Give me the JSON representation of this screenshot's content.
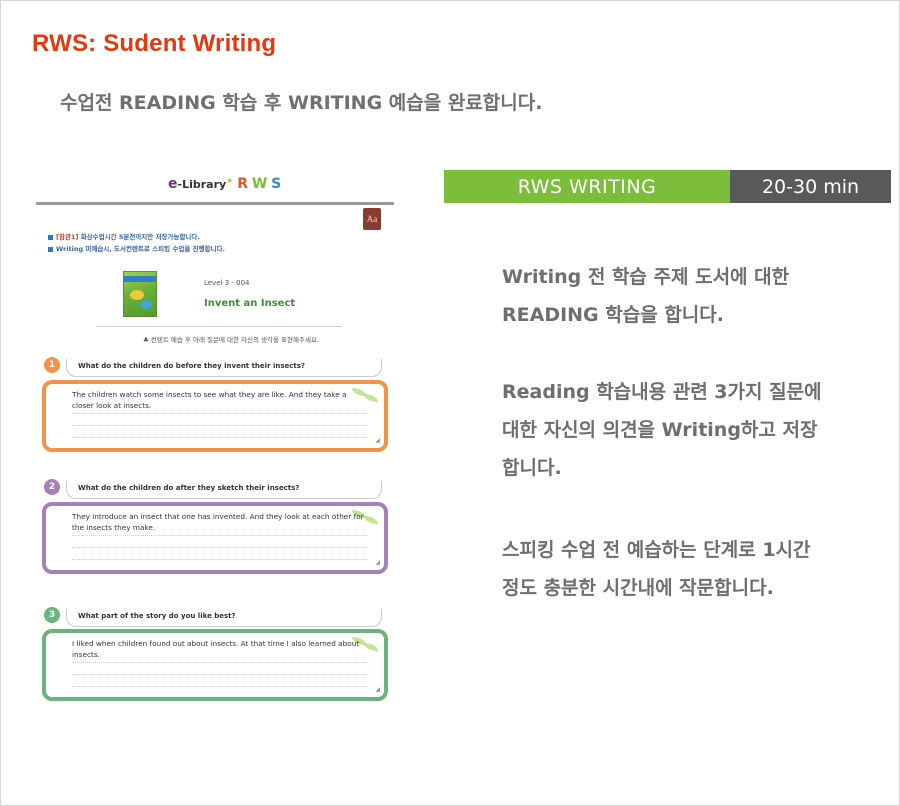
{
  "page": {
    "title": "RWS: Sudent Writing",
    "subtitle": "수업전 READING 학습 후 WRITING 예습을 완료합니다."
  },
  "preview": {
    "logo": {
      "e": "e",
      "library": "-Library",
      "r": "R",
      "w": "W",
      "s": "S"
    },
    "font_button": "Aa",
    "notices": [
      {
        "tag": "[참관1]",
        "text": " 화상수업시간 5분전까지만 저장가능합니다."
      },
      {
        "tag": "",
        "text": "Writing 미예습시, 도서컨텐트로 스피킹 수업을 진행합니다."
      }
    ],
    "book": {
      "level": "Level 3 - 004",
      "title": "Invent an Insect"
    },
    "instruction": "♣ 컨텐트 예습 후 아래 질문에 대한 자신의 생각을 표현해주세요.",
    "questions": [
      {
        "num": "1",
        "text": "What do the children do before they invent their insects?",
        "answer": "The children watch some insects to see what they are like. And they take a closer look at insects.",
        "color": "#f4924a"
      },
      {
        "num": "2",
        "text": "What do the children do after they sketch their insects?",
        "answer": "They introduce an insect that one has invented. And they look at each other for the insects they make.",
        "color": "#a581b8"
      },
      {
        "num": "3",
        "text": "What part of the story do you like best?",
        "answer": "I liked when children found out about insects. At that time I also learned about insects.",
        "color": "#6cb37c"
      }
    ]
  },
  "rws": {
    "label": "RWS WRITING",
    "time": "20-30 min",
    "accent": "#7dbd3c",
    "dark": "#595959"
  },
  "descriptions": [
    {
      "lines": [
        "Writing 전 학습 주제 도서에 대한",
        "READING 학습을 합니다."
      ]
    },
    {
      "lines": [
        "Reading 학습내용 관련 3가지 질문에",
        "대한 자신의 의견을 Writing하고 저장",
        "합니다."
      ]
    },
    {
      "lines": [
        "스피킹 수업 전 예습하는 단계로 1시간",
        "정도 충분한 시간내에 작문합니다."
      ]
    }
  ]
}
